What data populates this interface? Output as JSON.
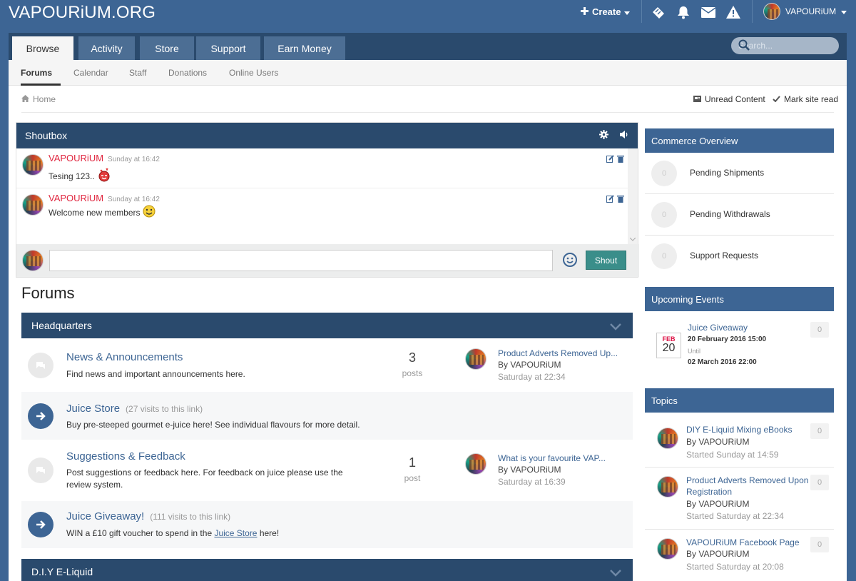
{
  "header": {
    "logo": "VAPOURiUM.ORG",
    "create_label": "Create",
    "user_name": "VAPOURiUM",
    "icons": [
      "ticket-icon",
      "bell-icon",
      "envelope-icon",
      "warning-icon"
    ]
  },
  "nav": {
    "tabs": [
      {
        "label": "Browse",
        "active": true
      },
      {
        "label": "Activity"
      },
      {
        "label": "Store"
      },
      {
        "label": "Support"
      },
      {
        "label": "Earn Money"
      }
    ],
    "search_placeholder": "Search..."
  },
  "subnav": {
    "items": [
      "Forums",
      "Calendar",
      "Staff",
      "Donations",
      "Online Users"
    ]
  },
  "breadcrumb": {
    "home": "Home",
    "unread": "Unread Content",
    "mark_read": "Mark site read"
  },
  "shoutbox": {
    "title": "Shoutbox",
    "messages": [
      {
        "author": "VAPOURiUM",
        "time": "Sunday at 16:42",
        "text": "Tesing 123.."
      },
      {
        "author": "VAPOURiUM",
        "time": "Sunday at 16:42",
        "text": "Welcome new members"
      }
    ],
    "button": "Shout"
  },
  "forums": {
    "title": "Forums",
    "categories": [
      {
        "name": "Headquarters"
      },
      {
        "name": "D.I.Y E-Liquid"
      }
    ],
    "rows": [
      {
        "title": "News & Announcements",
        "desc": "Find news and important announcements here.",
        "count": "3",
        "count_label": "posts",
        "last_title": "Product Adverts Removed Up...",
        "last_by": "By VAPOURiUM",
        "last_date": "Saturday at 22:34"
      },
      {
        "title": "Juice Store",
        "visits": "(27 visits to this link)",
        "desc": "Buy pre-steeped gourmet e-juice here! See individual flavours for more detail."
      },
      {
        "title": "Suggestions & Feedback",
        "desc": "Post suggestions or feedback here. For feedback on juice please use the review system.",
        "count": "1",
        "count_label": "post",
        "last_title": "What is your favourite VAP...",
        "last_by": "By VAPOURiUM",
        "last_date": "Saturday at 16:39"
      },
      {
        "title": "Juice Giveaway!",
        "visits": "(111 visits to this link)",
        "desc_pre": "WIN a £10 gift voucher to spend in the ",
        "desc_link": "Juice Store",
        "desc_post": " here!"
      }
    ]
  },
  "sidebar": {
    "commerce": {
      "title": "Commerce Overview",
      "rows": [
        {
          "count": "0",
          "label": "Pending Shipments"
        },
        {
          "count": "0",
          "label": "Pending Withdrawals"
        },
        {
          "count": "0",
          "label": "Support Requests"
        }
      ]
    },
    "events": {
      "title": "Upcoming Events",
      "event": {
        "month": "FEB",
        "day": "20",
        "title": "Juice Giveaway",
        "start": "20 February 2016 15:00",
        "until": "Until",
        "end": "02 March 2016 22:00",
        "count": "0"
      }
    },
    "topics": {
      "title": "Topics",
      "items": [
        {
          "title": "DIY E-Liquid Mixing eBooks",
          "by": "By VAPOURiUM",
          "date": "Started Sunday at 14:59",
          "count": "0"
        },
        {
          "title": "Product Adverts Removed Upon Registration",
          "by": "By VAPOURiUM",
          "date": "Started Saturday at 22:34",
          "count": "0"
        },
        {
          "title": "VAPOURiUM Facebook Page",
          "by": "By VAPOURiUM",
          "date": "Started Saturday at 20:08",
          "count": "0"
        }
      ]
    }
  },
  "colors": {
    "brand": "#3d6594",
    "dark": "#2a4a6d",
    "shout_author": "#e0263f",
    "shout_button": "#3a8e8a"
  }
}
